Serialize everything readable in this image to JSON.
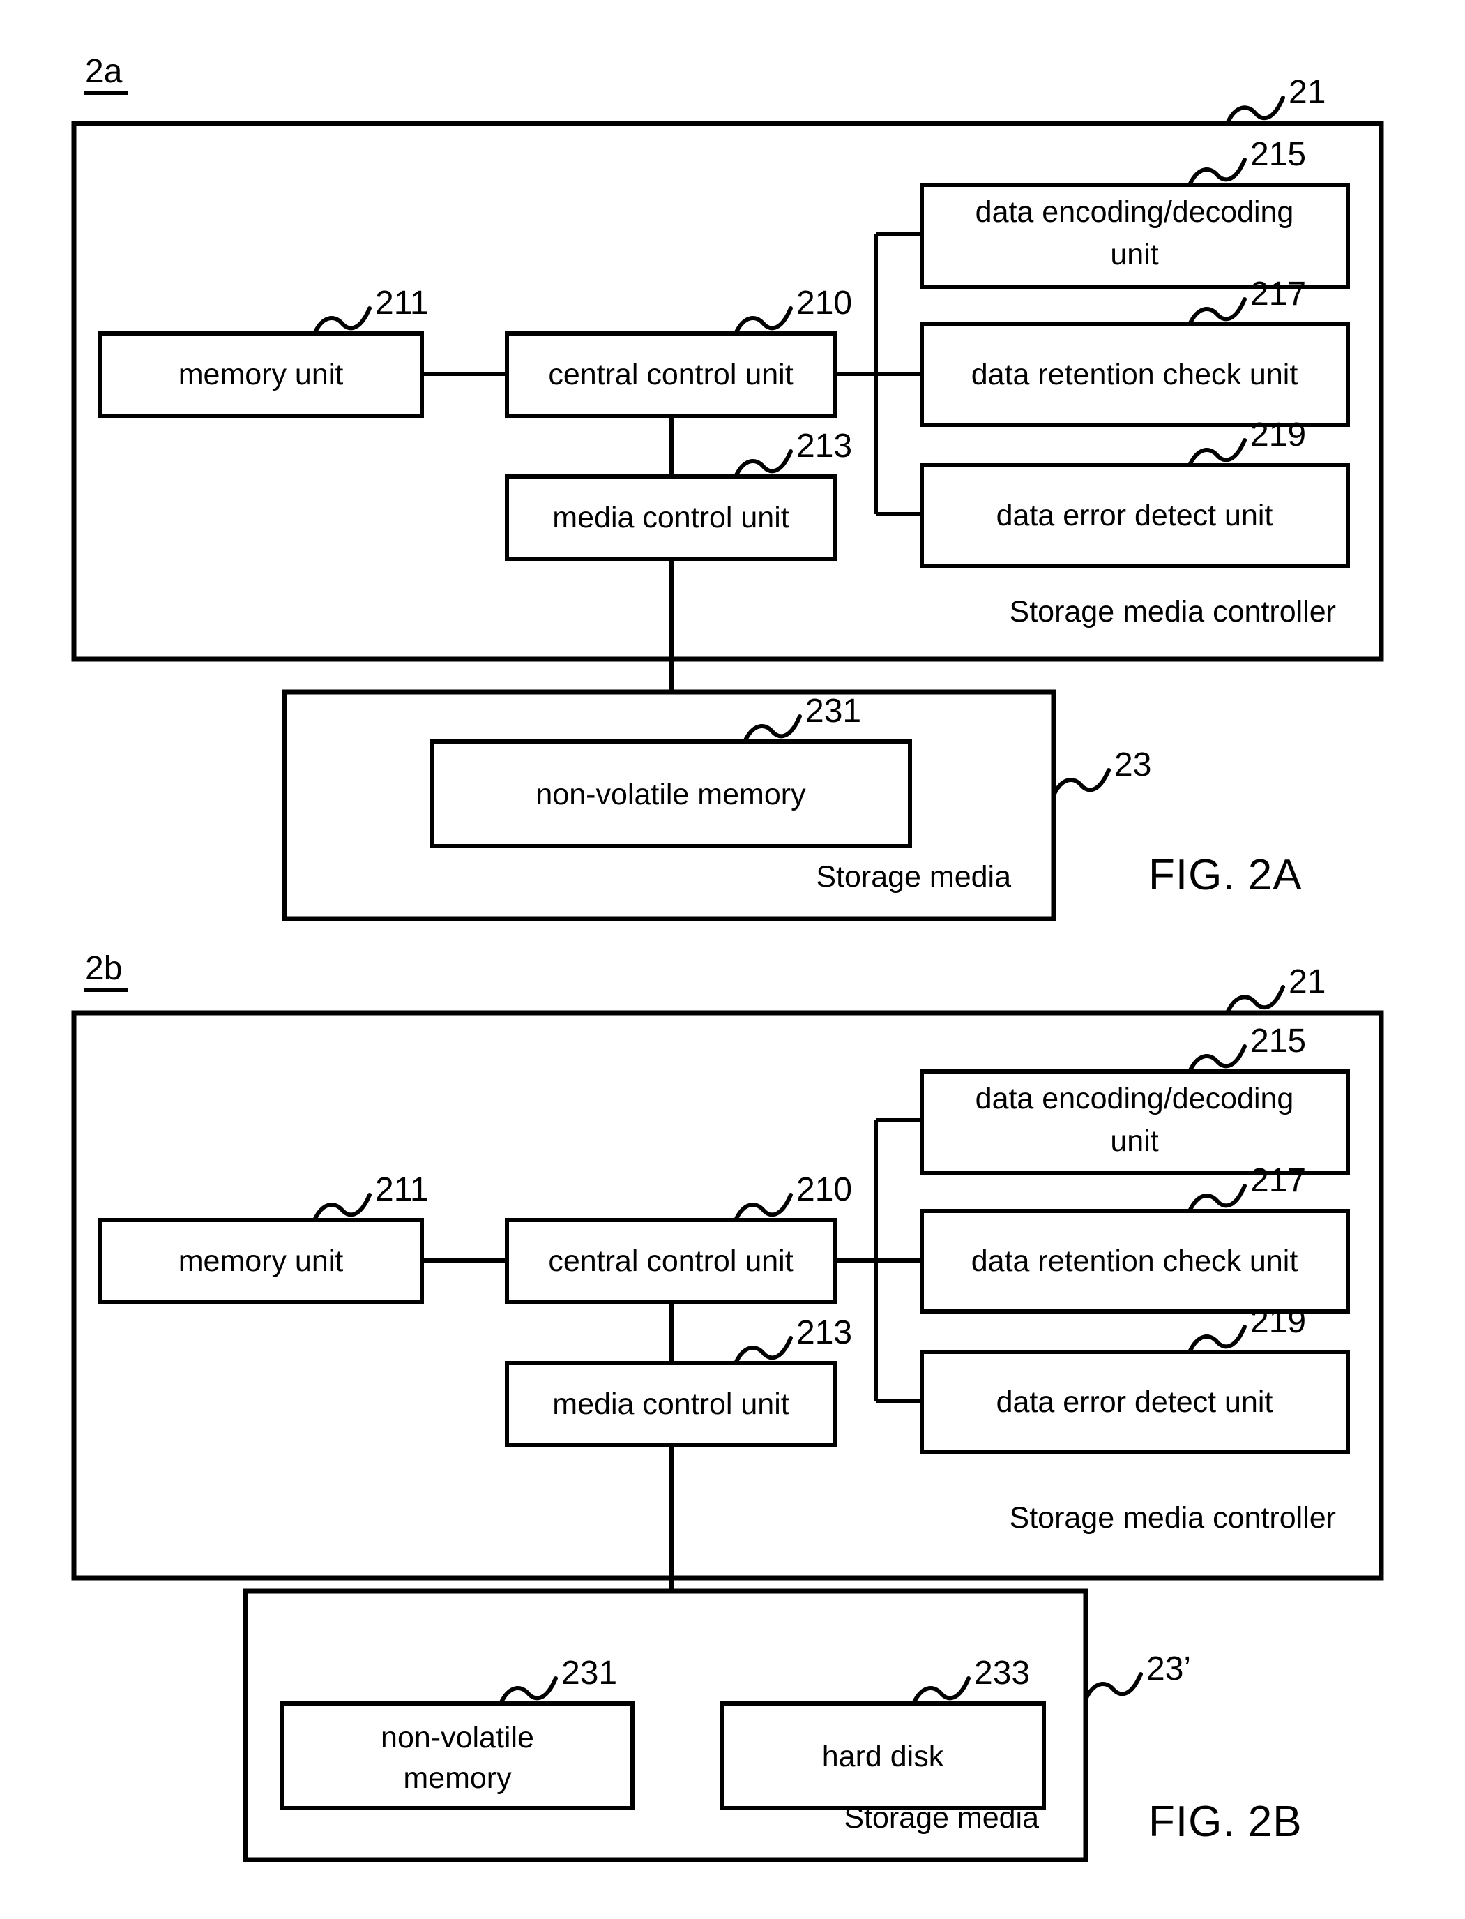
{
  "document": {
    "kind": "patent-figure-sheet",
    "figures": [
      {
        "id": "fig-2a",
        "panel_label": "2a",
        "caption": "FIG. 2A",
        "controller": {
          "region_label": "Storage media controller",
          "region_ref": "21",
          "blocks": [
            {
              "id": "memory-unit",
              "label": "memory unit",
              "label_line2": "",
              "ref": "211"
            },
            {
              "id": "central-control-unit",
              "label": "central control unit",
              "label_line2": "",
              "ref": "210"
            },
            {
              "id": "media-control-unit",
              "label": "media control unit",
              "label_line2": "",
              "ref": "213"
            },
            {
              "id": "data-encoding-decoding-unit",
              "label": "data encoding/decoding",
              "label_line2": "unit",
              "ref": "215"
            },
            {
              "id": "data-retention-check-unit",
              "label": "data retention check unit",
              "label_line2": "",
              "ref": "217"
            },
            {
              "id": "data-error-detect-unit",
              "label": "data error detect unit",
              "label_line2": "",
              "ref": "219"
            }
          ]
        },
        "storage_media": {
          "region_label": "Storage media",
          "region_ref": "23",
          "blocks": [
            {
              "id": "non-volatile-memory",
              "label": "non-volatile memory",
              "label_line2": "",
              "ref": "231"
            }
          ]
        }
      },
      {
        "id": "fig-2b",
        "panel_label": "2b",
        "caption": "FIG. 2B",
        "controller": {
          "region_label": "Storage media controller",
          "region_ref": "21",
          "blocks": [
            {
              "id": "memory-unit",
              "label": "memory unit",
              "label_line2": "",
              "ref": "211"
            },
            {
              "id": "central-control-unit",
              "label": "central control unit",
              "label_line2": "",
              "ref": "210"
            },
            {
              "id": "media-control-unit",
              "label": "media control unit",
              "label_line2": "",
              "ref": "213"
            },
            {
              "id": "data-encoding-decoding-unit",
              "label": "data encoding/decoding",
              "label_line2": "unit",
              "ref": "215"
            },
            {
              "id": "data-retention-check-unit",
              "label": "data retention check unit",
              "label_line2": "",
              "ref": "217"
            },
            {
              "id": "data-error-detect-unit",
              "label": "data error detect unit",
              "label_line2": "",
              "ref": "219"
            }
          ]
        },
        "storage_media": {
          "region_label": "Storage media",
          "region_ref": "23’",
          "blocks": [
            {
              "id": "non-volatile-memory",
              "label": "non-volatile",
              "label_line2": "memory",
              "ref": "231"
            },
            {
              "id": "hard-disk",
              "label": "hard disk",
              "label_line2": "",
              "ref": "233"
            }
          ]
        }
      }
    ],
    "colors": {
      "ink": "#000000",
      "paper": "#ffffff"
    }
  },
  "fig2a": {
    "panel_label": "2a",
    "caption": "FIG. 2A",
    "controller_ref": "21",
    "controller_region_label": "Storage media controller",
    "memory_unit": "memory unit",
    "memory_unit_ref": "211",
    "central_control_unit": "central control unit",
    "central_control_unit_ref": "210",
    "media_control_unit": "media control unit",
    "media_control_unit_ref": "213",
    "data_encoding_line1": "data encoding/decoding",
    "data_encoding_line2": "unit",
    "data_encoding_ref": "215",
    "data_retention": "data retention check unit",
    "data_retention_ref": "217",
    "data_error": "data error detect unit",
    "data_error_ref": "219",
    "storage_media_region_label": "Storage media",
    "storage_media_ref": "23",
    "non_volatile_memory": "non-volatile memory",
    "non_volatile_memory_ref": "231"
  },
  "fig2b": {
    "panel_label": "2b",
    "caption": "FIG. 2B",
    "controller_ref": "21",
    "controller_region_label": "Storage media controller",
    "memory_unit": "memory unit",
    "memory_unit_ref": "211",
    "central_control_unit": "central control unit",
    "central_control_unit_ref": "210",
    "media_control_unit": "media control unit",
    "media_control_unit_ref": "213",
    "data_encoding_line1": "data encoding/decoding",
    "data_encoding_line2": "unit",
    "data_encoding_ref": "215",
    "data_retention": "data retention check unit",
    "data_retention_ref": "217",
    "data_error": "data error detect unit",
    "data_error_ref": "219",
    "storage_media_region_label": "Storage media",
    "storage_media_ref": "23’",
    "non_volatile_memory_line1": "non-volatile",
    "non_volatile_memory_line2": "memory",
    "non_volatile_memory_ref": "231",
    "hard_disk": "hard disk",
    "hard_disk_ref": "233"
  }
}
